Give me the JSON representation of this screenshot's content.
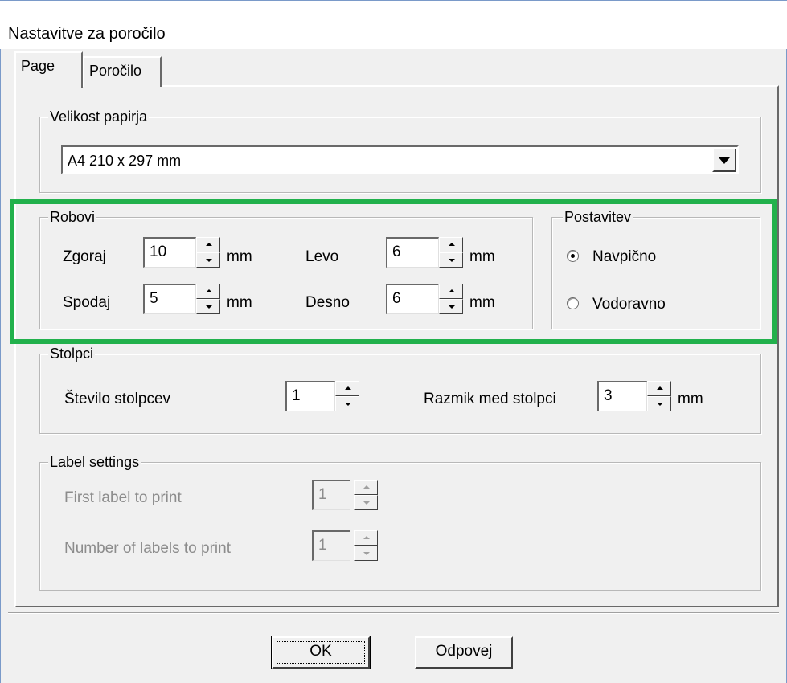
{
  "window": {
    "title": "Nastavitve za poročilo"
  },
  "tabs": [
    {
      "label": "Page"
    },
    {
      "label": "Poročilo"
    }
  ],
  "paper": {
    "legend": "Velikost papirja",
    "selected": "A4 210 x 297 mm"
  },
  "margins": {
    "legend": "Robovi",
    "top_label": "Zgoraj",
    "top_value": "10",
    "bottom_label": "Spodaj",
    "bottom_value": "5",
    "left_label": "Levo",
    "left_value": "6",
    "right_label": "Desno",
    "right_value": "6",
    "unit": "mm"
  },
  "orientation": {
    "legend": "Postavitev",
    "portrait_label": "Navpično",
    "landscape_label": "Vodoravno",
    "selected": "portrait"
  },
  "columns": {
    "legend": "Stolpci",
    "count_label": "Število stolpcev",
    "count_value": "1",
    "spacing_label": "Razmik med stolpci",
    "spacing_value": "3",
    "unit": "mm"
  },
  "labels": {
    "legend": "Label settings",
    "first_label": "First label to print",
    "first_value": "1",
    "count_label": "Number of labels to print",
    "count_value": "1"
  },
  "buttons": {
    "ok": "OK",
    "cancel": "Odpovej"
  },
  "colors": {
    "highlight": "#22b14c",
    "dialog_bg": "#f0f0f0"
  }
}
